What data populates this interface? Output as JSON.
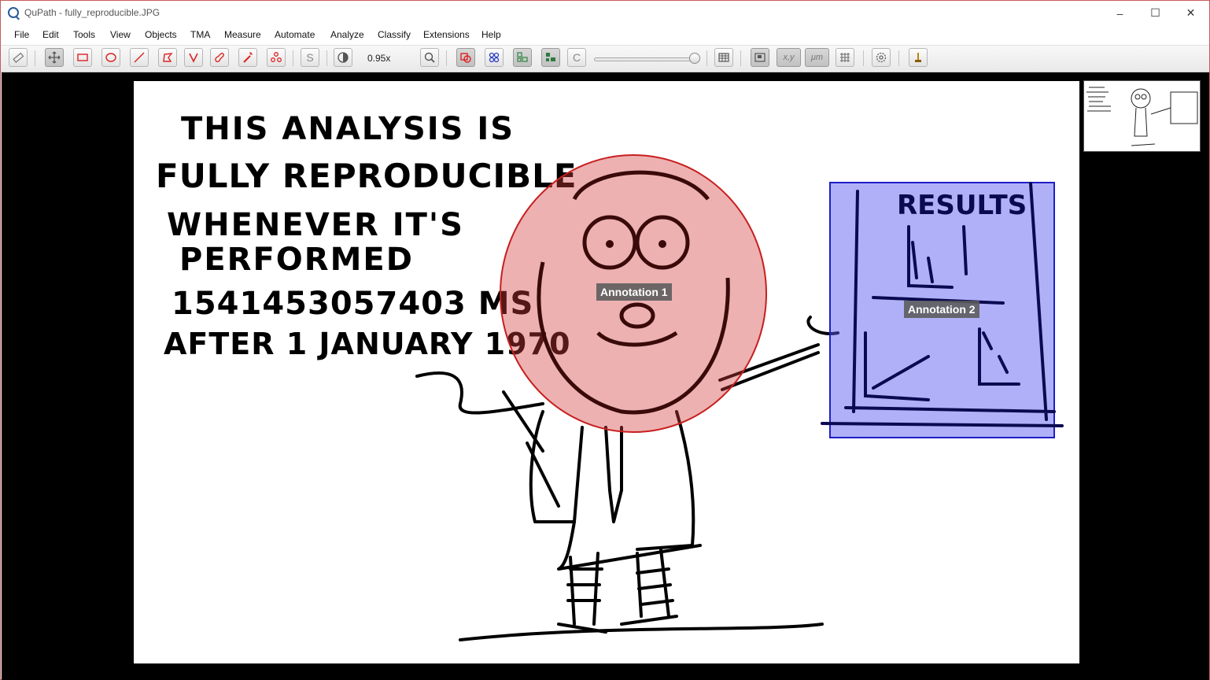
{
  "window": {
    "title": "QuPath - fully_reproducible.JPG"
  },
  "menus": [
    "File",
    "Edit",
    "Tools",
    "View",
    "Objects",
    "TMA",
    "Measure",
    "Automate",
    "Analyze",
    "Classify",
    "Extensions",
    "Help"
  ],
  "toolbar": {
    "zoom": "0.95x",
    "icons": [
      "ruler-icon",
      "move-icon",
      "rectangle-icon",
      "ellipse-icon",
      "line-icon",
      "polygon-icon",
      "polyline-icon",
      "brush-icon",
      "wand-icon",
      "points-icon",
      "selection-mode-icon",
      "brightness-contrast-icon",
      "zoom-to-fit-icon",
      "show-annotations-icon",
      "show-tma-grid-icon",
      "show-detections-icon",
      "fill-detections-icon",
      "show-connections-icon",
      "opacity-slider",
      "measurement-table-icon",
      "overview-icon",
      "location-icon",
      "scalebar-icon",
      "grid-icon",
      "preferences-icon",
      "log-icon"
    ],
    "toggle_labels": {
      "selection_mode": "S",
      "connections": "C",
      "location": "x,y",
      "scalebar": "μm"
    },
    "opacity": 1.0
  },
  "image": {
    "handwriting": [
      "THIS ANALYSIS IS",
      "FULLY REPRODUCIBLE",
      "WHENEVER IT'S",
      "PERFORMED",
      "1541453057403 MS",
      "AFTER 1 JANUARY 1970"
    ],
    "board_text": "RESULTS"
  },
  "annotations": [
    {
      "name": "Annotation 1",
      "shape": "ellipse",
      "color": "#c81e1e"
    },
    {
      "name": "Annotation 2",
      "shape": "rectangle",
      "color": "#1e1ec8"
    }
  ]
}
